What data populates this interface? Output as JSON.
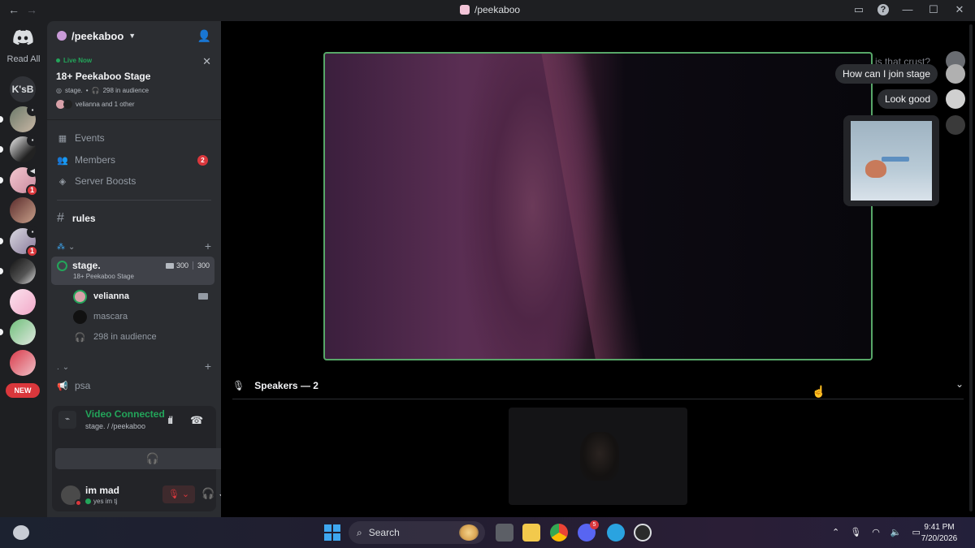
{
  "window": {
    "title": "/peekaboo",
    "back_icon": "←",
    "forward_icon": "→"
  },
  "rail": {
    "read_all": "Read All",
    "ksb_label": "K'sB",
    "badges": [
      "1",
      "1"
    ],
    "new_label": "NEW"
  },
  "server": {
    "name": "/peekaboo",
    "live": {
      "status": "Live Now",
      "title": "18+ Peekaboo Stage",
      "channel": "stage.",
      "audience": "298 in audience",
      "speakers": "velianna and 1 other"
    },
    "nav": [
      {
        "label": "Events"
      },
      {
        "label": "Members",
        "count": "2"
      },
      {
        "label": "Server Boosts"
      }
    ],
    "rules_channel": "rules",
    "stage_channel": {
      "name": "stage.",
      "topic": "18+ Peekaboo Stage",
      "video_count": "300",
      "user_count": "300"
    },
    "members": [
      {
        "name": "velianna"
      },
      {
        "name": "mascara"
      }
    ],
    "audience": "298 in audience",
    "other_category": ".",
    "psa_channel": "psa"
  },
  "voice": {
    "status": "Video Connected",
    "location": "stage. / /peekaboo"
  },
  "user": {
    "name": "im mad",
    "status": "yes im tj"
  },
  "stage_view": {
    "chat": [
      {
        "text": "is that crust?",
        "faded": true
      },
      {
        "text": "How can I join stage"
      },
      {
        "text": "Look good"
      }
    ],
    "speakers_label": "Speakers — 2"
  },
  "taskbar": {
    "search_placeholder": "Search",
    "discord_badge": "5",
    "time": "9:41 PM",
    "date": "7/20/2026"
  },
  "colors": {
    "accent_green": "#23a55a",
    "danger_red": "#da373c",
    "video_border": "#57a768"
  }
}
